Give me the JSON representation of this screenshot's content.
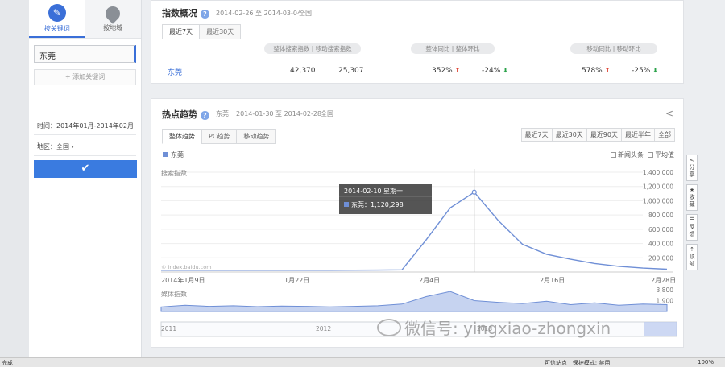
{
  "sidebar": {
    "tab_keyword": "按关键词",
    "tab_region": "按地域",
    "keyword": "东莞",
    "add_keyword": "+ 添加关键词",
    "time_filter": "时间：2014年01月-2014年02月 ›",
    "region_filter": "地区：全国 ›",
    "confirm_icon": "check-icon"
  },
  "overview": {
    "title": "指数概况",
    "date_range": "2014-02-26 至 2014-03-04",
    "region": "全国",
    "tabs": [
      "最近7天",
      "最近30天"
    ],
    "col_headers": [
      "整体搜索指数",
      "移动搜索指数",
      "整体同比",
      "整体环比",
      "移动同比",
      "移动环比"
    ],
    "row": {
      "keyword": "东莞",
      "total": "42,370",
      "mobile": "25,307",
      "total_yoy": "352%",
      "total_mom": "-24%",
      "mobile_yoy": "578%",
      "mobile_mom": "-25%"
    }
  },
  "trend": {
    "title": "热点趋势",
    "keyword": "东莞",
    "date_range": "2014-01-30 至 2014-02-28",
    "region": "全国",
    "tabs": [
      "整体趋势",
      "PC趋势",
      "移动趋势"
    ],
    "ranges": [
      "最近7天",
      "最近30天",
      "最近90天",
      "最近半年",
      "全部"
    ],
    "legend": "东莞",
    "checkbox_news": "新闻头条",
    "checkbox_avg": "平均值",
    "search_label": "搜索指数",
    "media_label": "媒体指数",
    "watermark_small": "© index.baidu.com",
    "tooltip_date": "2014-02-10 星期一",
    "tooltip_value": "东莞：1,120,298",
    "colors": {
      "line": "#6f8fd6",
      "fill": "#c6d3f0",
      "accent": "#3a7be0"
    }
  },
  "chart_data": {
    "type": "line",
    "title": "",
    "xlabel": "",
    "ylabel": "搜索指数",
    "x_ticks": [
      "2014年1月9日",
      "1月22日",
      "2月4日",
      "2月16日",
      "2月28日"
    ],
    "y_ticks": [
      "200,000",
      "400,000",
      "600,000",
      "800,000",
      "1,000,000",
      "1,200,000",
      "1,400,000"
    ],
    "ylim": [
      0,
      1400000
    ],
    "series": [
      {
        "name": "东莞",
        "x": [
          "01-09",
          "01-12",
          "01-15",
          "01-18",
          "01-21",
          "01-24",
          "01-27",
          "01-30",
          "02-02",
          "02-05",
          "02-07",
          "02-08",
          "02-09",
          "02-10",
          "02-11",
          "02-12",
          "02-13",
          "02-15",
          "02-18",
          "02-21",
          "02-24",
          "02-28"
        ],
        "values": [
          25000,
          25000,
          25000,
          25000,
          25000,
          25000,
          25000,
          25000,
          26000,
          27000,
          30000,
          450000,
          900000,
          1120298,
          720000,
          390000,
          250000,
          180000,
          120000,
          80000,
          55000,
          40000
        ]
      }
    ],
    "media": {
      "label": "媒体指数",
      "y_ticks": [
        "1,900",
        "3,800"
      ],
      "ylim": [
        0,
        3800
      ],
      "values": [
        800,
        1100,
        900,
        1000,
        850,
        950,
        900,
        800,
        900,
        1000,
        1300,
        2600,
        3500,
        1900,
        1600,
        1400,
        1800,
        1200,
        1500,
        1100,
        1300,
        1200
      ]
    },
    "navigator_years": [
      "2011",
      "2012",
      "2013"
    ],
    "legend_position": "top-left",
    "grid": true
  },
  "right_tools": [
    "分享",
    "收藏",
    "反馈",
    "顶部"
  ],
  "statusbar": {
    "left": "完成",
    "center": "可信站点 | 保护模式: 禁用",
    "zoom": "100%"
  },
  "watermark": "微信号: yingxiao-zhongxin"
}
